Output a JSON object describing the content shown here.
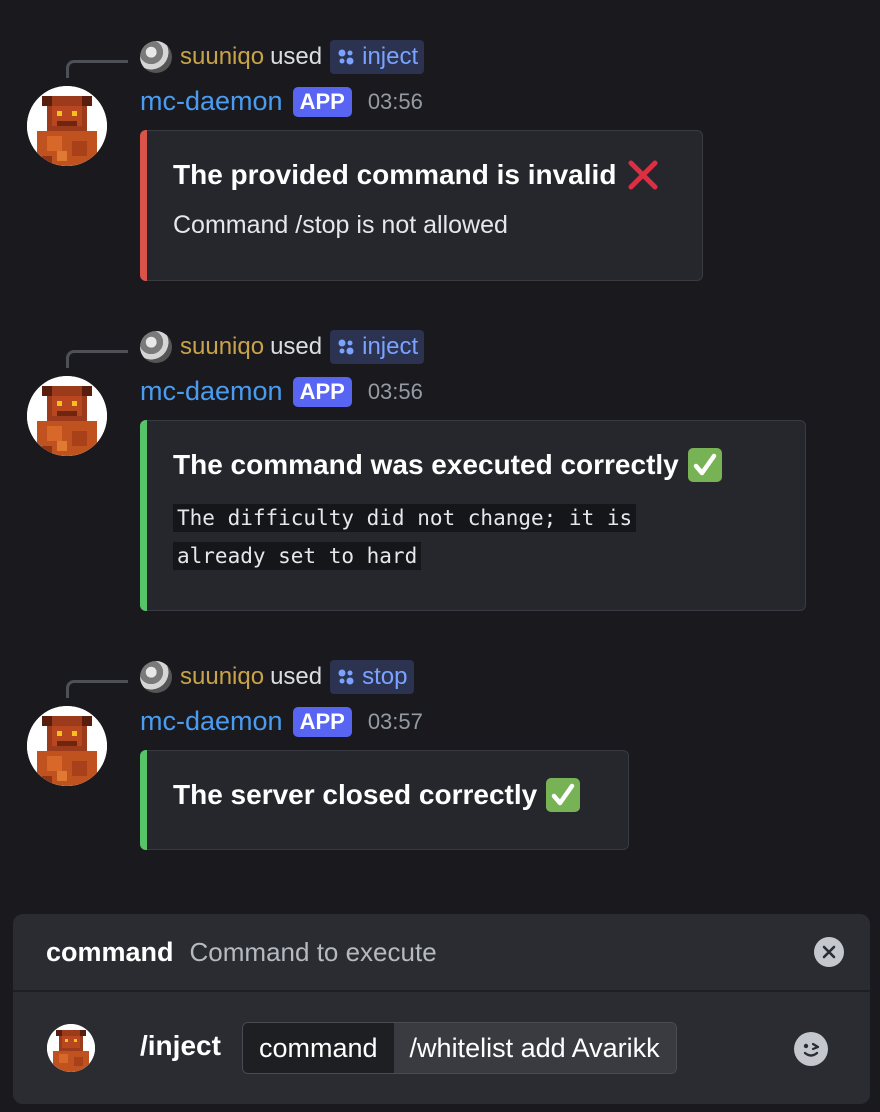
{
  "messages": [
    {
      "reply_user": "suuniqo",
      "reply_used": "used",
      "command": "inject",
      "bot_name": "mc-daemon",
      "badge": "APP",
      "time": "03:56",
      "embed_color": "#d9534a",
      "title": "The provided command is invalid",
      "title_icon": "cross-mark-icon",
      "description": "Command /stop is not allowed"
    },
    {
      "reply_user": "suuniqo",
      "reply_used": "used",
      "command": "inject",
      "bot_name": "mc-daemon",
      "badge": "APP",
      "time": "03:56",
      "embed_color": "#57c46a",
      "title": "The command was executed correctly",
      "title_icon": "check-mark-icon",
      "code_line1": "The difficulty did not change; it is",
      "code_line2": "already set to hard"
    },
    {
      "reply_user": "suuniqo",
      "reply_used": "used",
      "command": "stop",
      "bot_name": "mc-daemon",
      "badge": "APP",
      "time": "03:57",
      "embed_color": "#57c46a",
      "title": "The server closed correctly",
      "title_icon": "check-mark-icon"
    }
  ],
  "command_bar": {
    "option_name": "command",
    "option_description": "Command to execute",
    "command": "/inject",
    "param_name": "command",
    "param_value": "/whitelist add Avarikk",
    "close_icon": "close-circle-icon",
    "emoji_icon": "emoji-picker-icon"
  },
  "colors": {
    "background": "#1a1a1e",
    "bot_name": "#4a9cf0",
    "reply_user": "#c9a34a",
    "app_badge": "#5865f2",
    "command_pill_text": "#7aa2ff"
  }
}
